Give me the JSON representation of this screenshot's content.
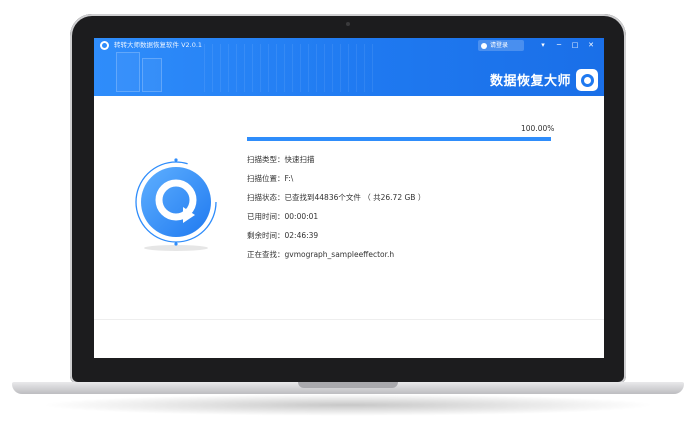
{
  "window": {
    "title": "转转大师数据恢复软件 V2.0.1",
    "login_label": "请登录",
    "controls": [
      "▾",
      "─",
      "□",
      "✕"
    ]
  },
  "brand": {
    "title": "数据恢复大师"
  },
  "progress": {
    "percent_label": "100.00%",
    "fraction": 1.0
  },
  "scan_info": [
    {
      "label": "扫描类型：",
      "value": "快速扫描"
    },
    {
      "label": "扫描位置：",
      "value": "F:\\"
    },
    {
      "label": "扫描状态：",
      "value": "已查找到44836个文件 （ 共26.72 GB ）"
    },
    {
      "label": "已用时间：",
      "value": "00:00:01"
    },
    {
      "label": "剩余时间：",
      "value": "02:46:39"
    },
    {
      "label": "正在查找：",
      "value": "gvmograph_sampleeffector.h"
    }
  ],
  "colors": {
    "accent": "#2f8dfb",
    "header_dark": "#1a6fe8",
    "text": "#333333"
  },
  "icons": {
    "app": "magnifier-q-logo",
    "login": "user-icon",
    "hero": "scan-magnifier-icon"
  }
}
